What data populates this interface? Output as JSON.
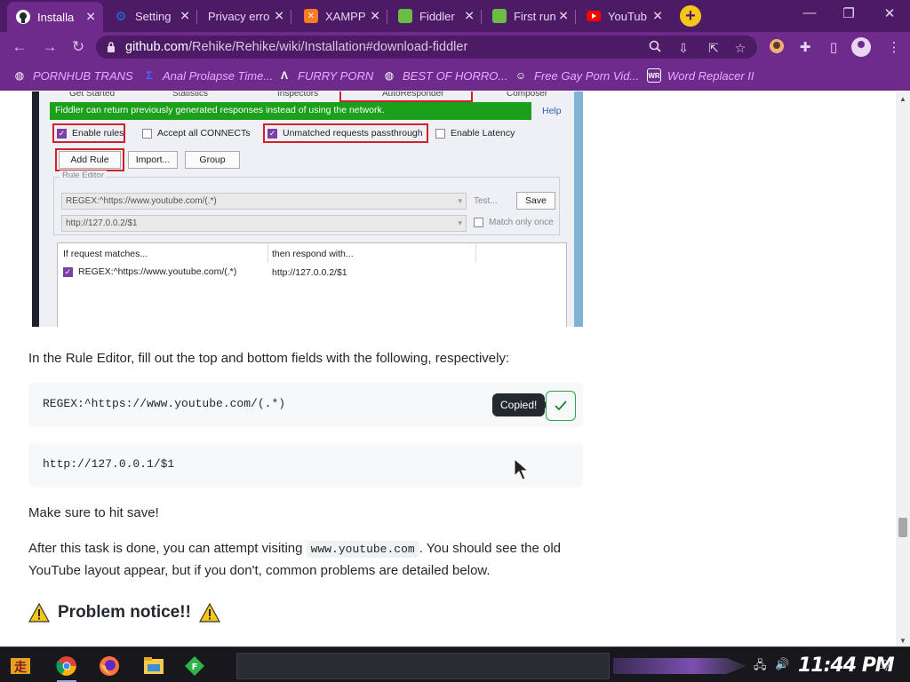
{
  "tabs": [
    {
      "title": "Installa",
      "icon": "github-icon",
      "color": "#24292f",
      "active": true
    },
    {
      "title": "Setting",
      "icon": "settings-gear-icon",
      "color": "#1a73e8"
    },
    {
      "title": "Privacy erro",
      "icon": "privacy-error-icon",
      "color": "#6e2b8c"
    },
    {
      "title": "XAMPP",
      "icon": "xampp-icon",
      "color": "#fb7a24"
    },
    {
      "title": "Fiddler",
      "icon": "fiddler-icon",
      "color": "#6cbd45"
    },
    {
      "title": "First run",
      "icon": "fiddler-icon",
      "color": "#6cbd45"
    },
    {
      "title": "YouTub",
      "icon": "youtube-icon",
      "color": "#ff0000"
    }
  ],
  "address": {
    "domain": "github.com",
    "path": "/Rehike/Rehike/wiki/Installation#download-fiddler"
  },
  "bookmarks": [
    {
      "label": "PORNHUB TRANS",
      "icon": "globe-icon"
    },
    {
      "label": "Anal Prolapse Time...",
      "icon": "bookmark-icon"
    },
    {
      "label": "FURRY PORN",
      "icon": "bookmark-icon"
    },
    {
      "label": "BEST OF HORRO...",
      "icon": "globe-icon"
    },
    {
      "label": "Free Gay Porn Vid...",
      "icon": "bookmark-icon"
    },
    {
      "label": "Word Replacer II",
      "icon": "extension-icon"
    }
  ],
  "fiddler": {
    "tabs": [
      "Get Started",
      "Statistics",
      "Inspectors",
      "AutoResponder",
      "Composer"
    ],
    "banner": "Fiddler can return previously generated responses instead of using the network.",
    "help": "Help",
    "enable_rules": "Enable rules",
    "accept_connects": "Accept all CONNECTs",
    "unmatched": "Unmatched requests passthrough",
    "enable_latency": "Enable Latency",
    "add_rule": "Add Rule",
    "import": "Import...",
    "group": "Group",
    "rule_editor": "Rule Editor",
    "match_value": "REGEX:^https://www.youtube.com/(.*)",
    "respond_value": "http://127.0.0.2/$1",
    "test": "Test...",
    "save": "Save",
    "match_only_once": "Match only once",
    "col_match": "If request matches...",
    "col_respond": "then respond with...",
    "row_match": "REGEX:^https://www.youtube.com/(.*)",
    "row_respond": "http://127.0.0.2/$1"
  },
  "content": {
    "para1": "In the Rule Editor, fill out the top and bottom fields with the following, respectively:",
    "code1": "REGEX:^https://www.youtube.com/(.*)",
    "copied": "Copied!",
    "code2": "http://127.0.0.1/$1",
    "para2": "Make sure to hit save!",
    "para3_pre": "After this task is done, you can attempt visiting",
    "para3_code": "www.youtube.com",
    "para3_post": ". You should see the old",
    "para3_line2": "YouTube layout appear, but if you don't, common problems are detailed below.",
    "heading": "Problem notice!!"
  },
  "taskbar": {
    "clock": "11:44 PM"
  },
  "colors": {
    "chrome_dark": "#4d1a66",
    "chrome": "#6e2b8c",
    "bookmark_text": "#f0a8ff",
    "fiddler_green": "#1aa01a",
    "highlight_red": "#d0202a"
  }
}
